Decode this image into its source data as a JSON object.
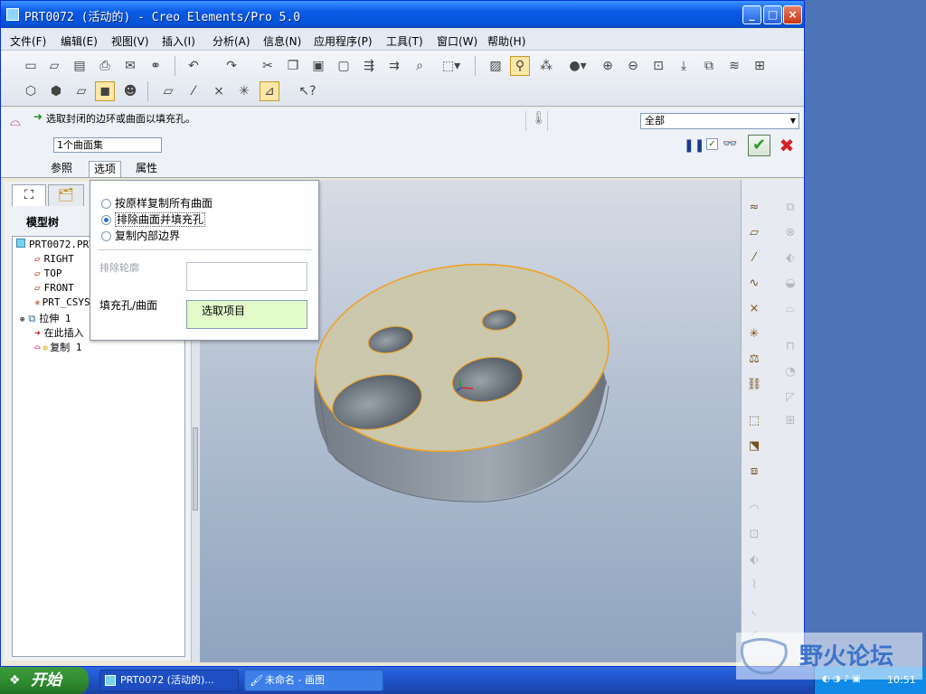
{
  "window": {
    "title": "PRT0072 (活动的) - Creo Elements/Pro 5.0"
  },
  "menubar": {
    "items": [
      "文件(F)",
      "编辑(E)",
      "视图(V)",
      "插入(I)",
      "分析(A)",
      "信息(N)",
      "应用程序(P)",
      "工具(T)",
      "窗口(W)",
      "帮助(H)"
    ]
  },
  "dashboard": {
    "prompt": "选取封闭的边环或曲面以填充孔。",
    "collector_value": "1个曲面集",
    "filter_value": "全部",
    "tabs": [
      "参照",
      "选项",
      "属性"
    ]
  },
  "options_panel": {
    "options": [
      "按原样复制所有曲面",
      "排除曲面并填充孔",
      "复制内部边界"
    ],
    "selected_index": 1,
    "exclude_label": "排除轮廓",
    "fill_label": "填充孔/曲面",
    "select_button": "选取项目"
  },
  "left_panel": {
    "title": "模型树",
    "tree": [
      "PRT0072.PRT",
      "RIGHT",
      "TOP",
      "FRONT",
      "PRT_CSYS_DEF",
      "拉伸 1",
      "在此插入",
      "复制 1"
    ]
  },
  "taskbar": {
    "start": "开始",
    "tasks": [
      "PRT0072 (活动的)...",
      "未命名 - 画图"
    ],
    "clock": "10:51"
  },
  "watermark": {
    "text": "野火论坛"
  },
  "colors": {
    "title": "#0553d6",
    "accent": "#fbe7a7",
    "selection": "#f0a020",
    "ok": "#2e9b2e",
    "cancel": "#d42020",
    "model": "#8a929c"
  }
}
